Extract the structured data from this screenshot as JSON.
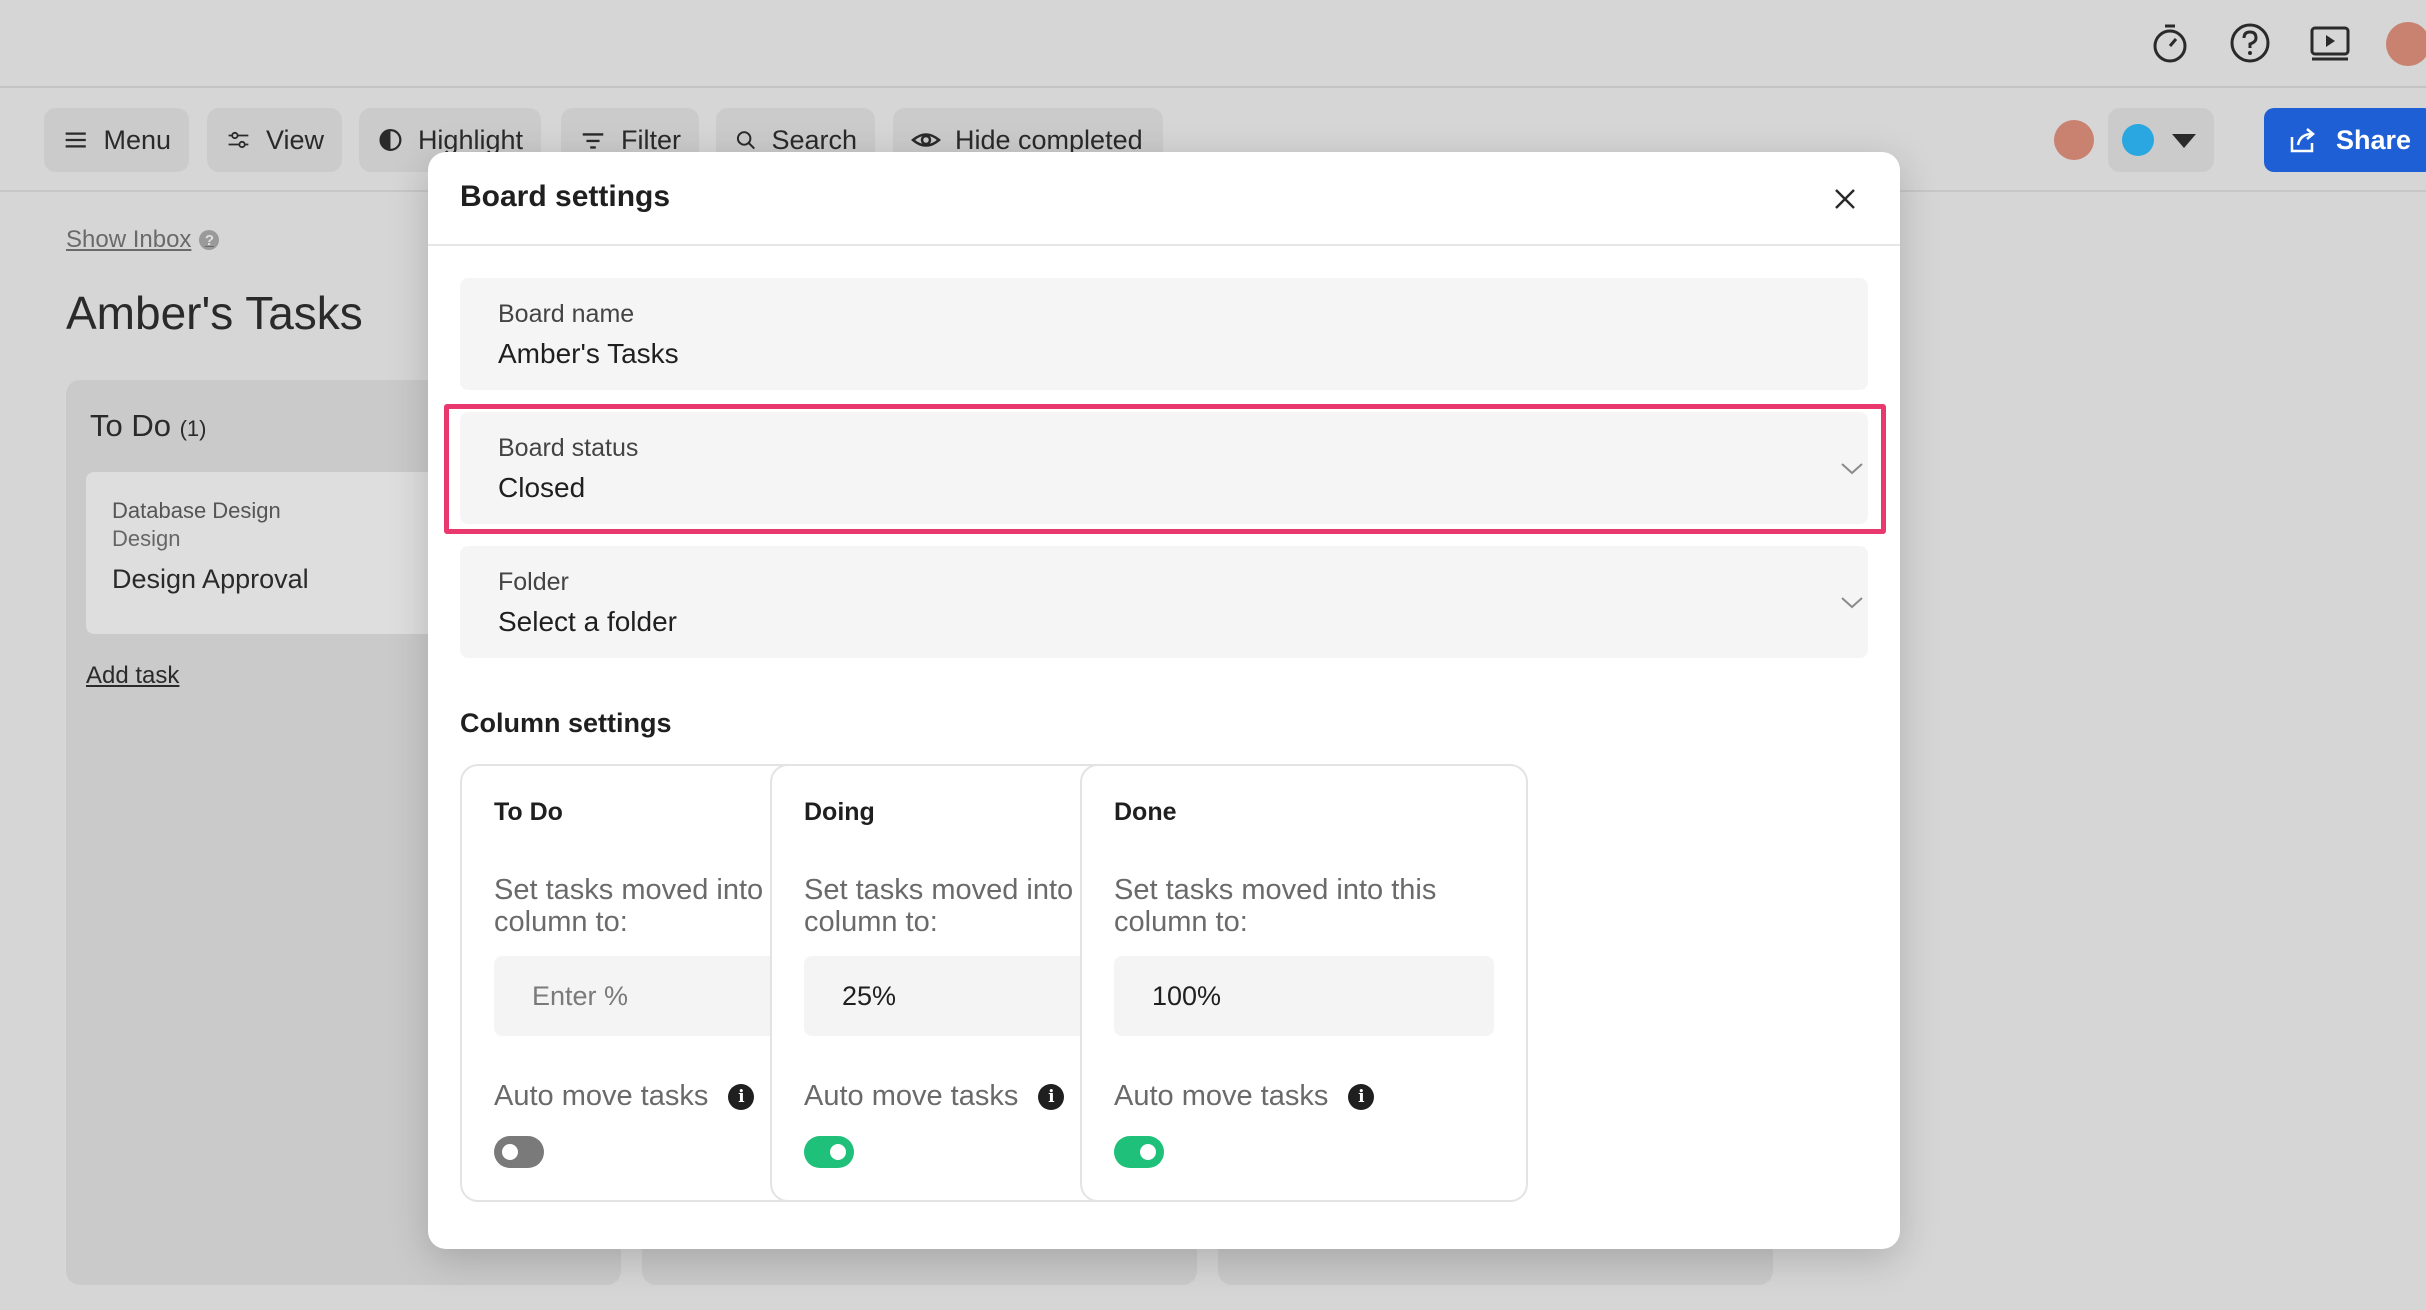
{
  "toolbar": {
    "menu_label": "Menu",
    "view_label": "View",
    "highlight_label": "Highlight",
    "filter_label": "Filter",
    "search_label": "Search",
    "hide_completed_label": "Hide completed",
    "share_label": "Share"
  },
  "board": {
    "show_inbox": "Show Inbox",
    "title": "Amber's Tasks",
    "column_name": "To Do",
    "column_count": "(1)",
    "task": {
      "project": "Database Design",
      "section": "Design",
      "name": "Design Approval"
    },
    "add_task": "Add task"
  },
  "modal": {
    "title": "Board settings",
    "board_name": {
      "label": "Board name",
      "value": "Amber's Tasks"
    },
    "board_status": {
      "label": "Board status",
      "value": "Closed"
    },
    "folder": {
      "label": "Folder",
      "value": "Select a folder"
    },
    "column_settings_title": "Column settings",
    "columns": [
      {
        "title": "To Do",
        "desc": "Set tasks moved into this column to:",
        "value": "",
        "placeholder": "Enter %",
        "auto_label": "Auto move tasks",
        "auto_move": false
      },
      {
        "title": "Doing",
        "desc": "Set tasks moved into this column to:",
        "value": "25%",
        "placeholder": "",
        "auto_label": "Auto move tasks",
        "auto_move": true
      },
      {
        "title": "Done",
        "desc": "Set tasks moved into this column to:",
        "value": "100%",
        "placeholder": "",
        "auto_label": "Auto move tasks",
        "auto_move": true
      }
    ]
  },
  "colors": {
    "share_button": "#1f5fd6",
    "highlight_border": "#e8386d",
    "toggle_on": "#1ec07a",
    "toggle_off": "#7a7a7a",
    "status_dot": "#2aa7e0"
  }
}
